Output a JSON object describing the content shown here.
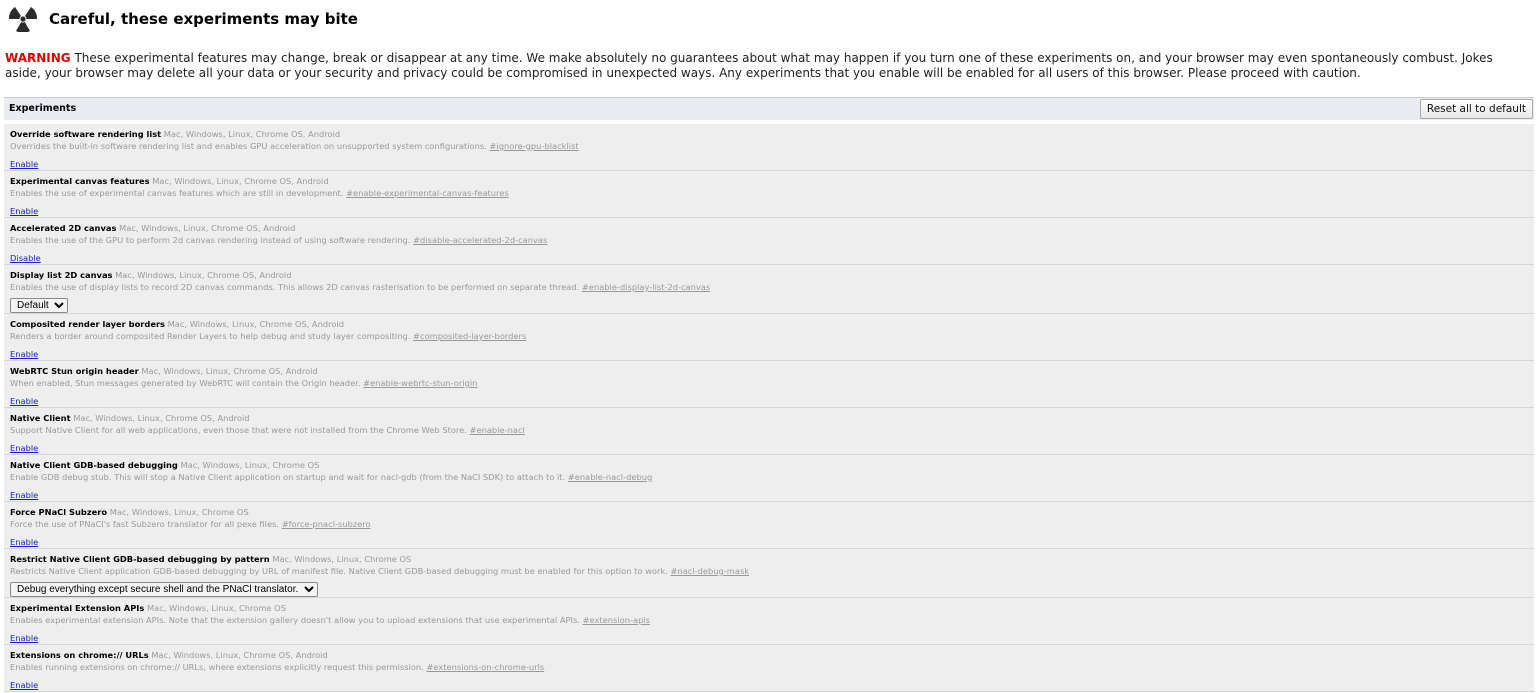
{
  "page": {
    "title": "Careful, these experiments may bite",
    "icon": "radiation-icon"
  },
  "warning": {
    "label": "WARNING",
    "text": " These experimental features may change, break or disappear at any time. We make absolutely no guarantees about what may happen if you turn one of these experiments on, and your browser may even spontaneously combust. Jokes aside, your browser may delete all your data or your security and privacy could be compromised in unexpected ways. Any experiments that you enable will be enabled for all users of this browser. Please proceed with caution."
  },
  "experiments_header": {
    "title": "Experiments",
    "reset_label": "Reset all to default"
  },
  "experiments": [
    {
      "name": "Override software rendering list",
      "platforms": "Mac, Windows, Linux, Chrome OS, Android",
      "description": "Overrides the built-in software rendering list and enables GPU acceleration on unsupported system configurations.",
      "anchor": "#ignore-gpu-blacklist",
      "action": "Enable"
    },
    {
      "name": "Experimental canvas features",
      "platforms": "Mac, Windows, Linux, Chrome OS, Android",
      "description": "Enables the use of experimental canvas features which are still in development.",
      "anchor": "#enable-experimental-canvas-features",
      "action": "Enable"
    },
    {
      "name": "Accelerated 2D canvas",
      "platforms": "Mac, Windows, Linux, Chrome OS, Android",
      "description": "Enables the use of the GPU to perform 2d canvas rendering instead of using software rendering.",
      "anchor": "#disable-accelerated-2d-canvas",
      "action": "Disable"
    },
    {
      "name": "Display list 2D canvas",
      "platforms": "Mac, Windows, Linux, Chrome OS, Android",
      "description": "Enables the use of display lists to record 2D canvas commands. This allows 2D canvas rasterisation to be performed on separate thread.",
      "anchor": "#enable-display-list-2d-canvas",
      "select": "Default"
    },
    {
      "name": "Composited render layer borders",
      "platforms": "Mac, Windows, Linux, Chrome OS, Android",
      "description": "Renders a border around composited Render Layers to help debug and study layer compositing.",
      "anchor": "#composited-layer-borders",
      "action": "Enable"
    },
    {
      "name": "WebRTC Stun origin header",
      "platforms": "Mac, Windows, Linux, Chrome OS, Android",
      "description": "When enabled, Stun messages generated by WebRTC will contain the Origin header.",
      "anchor": "#enable-webrtc-stun-origin",
      "action": "Enable"
    },
    {
      "name": "Native Client",
      "platforms": "Mac, Windows, Linux, Chrome OS, Android",
      "description": "Support Native Client for all web applications, even those that were not installed from the Chrome Web Store.",
      "anchor": "#enable-nacl",
      "action": "Enable"
    },
    {
      "name": "Native Client GDB-based debugging",
      "platforms": "Mac, Windows, Linux, Chrome OS",
      "description": "Enable GDB debug stub. This will stop a Native Client application on startup and wait for nacl-gdb (from the NaCl SDK) to attach to it.",
      "anchor": "#enable-nacl-debug",
      "action": "Enable"
    },
    {
      "name": "Force PNaCl Subzero",
      "platforms": "Mac, Windows, Linux, Chrome OS",
      "description": "Force the use of PNaCl's fast Subzero translator for all pexe files.",
      "anchor": "#force-pnacl-subzero",
      "action": "Enable"
    },
    {
      "name": "Restrict Native Client GDB-based debugging by pattern",
      "platforms": "Mac, Windows, Linux, Chrome OS",
      "description": "Restricts Native Client application GDB-based debugging by URL of manifest file. Native Client GDB-based debugging must be enabled for this option to work.",
      "anchor": "#nacl-debug-mask",
      "select": "Debug everything except secure shell and the PNaCl translator."
    },
    {
      "name": "Experimental Extension APIs",
      "platforms": "Mac, Windows, Linux, Chrome OS",
      "description": "Enables experimental extension APIs. Note that the extension gallery doesn't allow you to upload extensions that use experimental APIs.",
      "anchor": "#extension-apis",
      "action": "Enable"
    },
    {
      "name": "Extensions on chrome:// URLs",
      "platforms": "Mac, Windows, Linux, Chrome OS, Android",
      "description": "Enables running extensions on chrome:// URLs, where extensions explicitly request this permission.",
      "anchor": "#extensions-on-chrome-urls",
      "action": "Enable"
    }
  ]
}
